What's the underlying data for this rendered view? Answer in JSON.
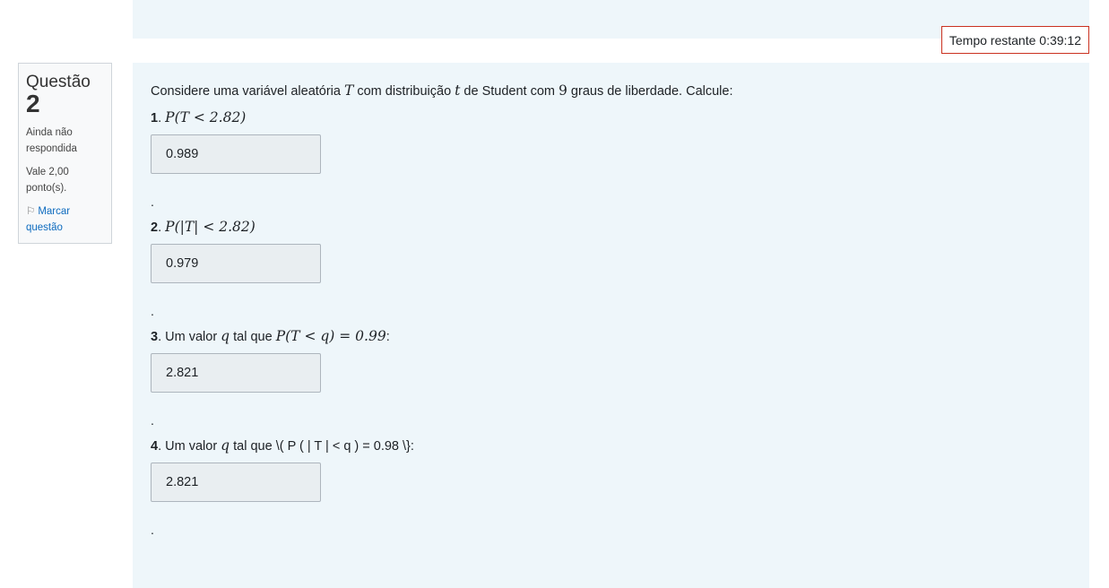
{
  "timer": {
    "label": "Tempo restante 0:39:12"
  },
  "info": {
    "question_label": "Questão",
    "question_number": "2",
    "status": "Ainda não respondida",
    "grade": "Vale 2,00 ponto(s).",
    "flag_label": "Marcar questão",
    "flag_icon": "flag-icon"
  },
  "question": {
    "intro_pre": "Considere uma variável aleatória ",
    "intro_var": "T",
    "intro_mid": " com distribuição ",
    "intro_t": "t",
    "intro_mid2": " de Student com ",
    "intro_df": "9",
    "intro_post": " graus de liberdade. Calcule:",
    "items": [
      {
        "num": "1",
        "sep": ". ",
        "expr": "P(T < 2.82)",
        "answer": "0.989"
      },
      {
        "num": "2",
        "sep": ". ",
        "expr": "P(|T| < 2.82)",
        "answer": "0.979"
      },
      {
        "num": "3",
        "sep": ".  Um valor ",
        "q": "q",
        "mid": " tal que ",
        "expr": "P(T < q) = 0.99",
        "post": ":",
        "answer": "2.821"
      },
      {
        "num": "4",
        "sep": ". Um valor ",
        "q": "q",
        "mid": " tal que \\( P ( | T | < q ) = 0.98 \\}:",
        "answer": "2.821"
      }
    ],
    "dot": "."
  }
}
